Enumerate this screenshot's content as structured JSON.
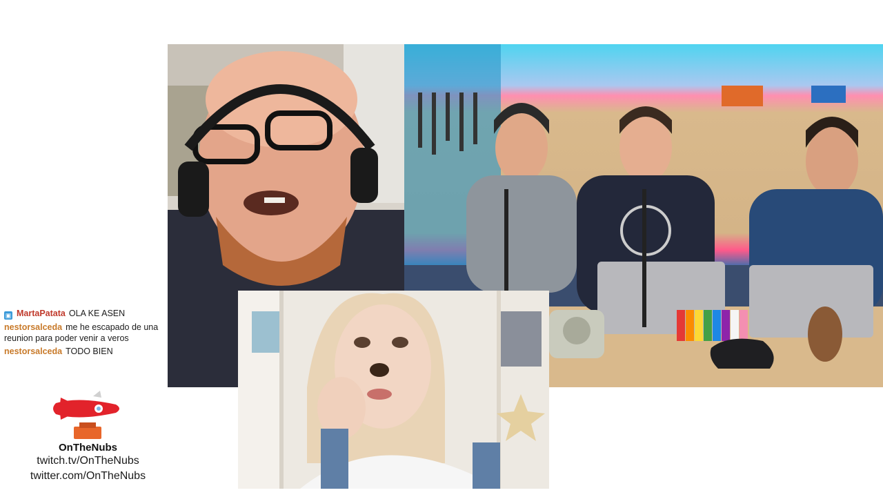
{
  "chat": {
    "messages": [
      {
        "user": "MartaPatata",
        "text": "OLA KE ASEN",
        "user_color": "#c0392b",
        "has_badge": true
      },
      {
        "user": "nestorsalceda",
        "text": "me he escapado de una reunion para poder venir a veros",
        "user_color": "#c87a2a",
        "has_badge": false
      },
      {
        "user": "nestorsalceda",
        "text": "TODO BIEN",
        "user_color": "#c87a2a",
        "has_badge": false
      }
    ]
  },
  "branding": {
    "name": "OnTheNubs",
    "twitch": "twitch.tv/OnTheNubs",
    "twitter": "twitter.com/OnTheNubs",
    "logo_icon": "rocket-logo-icon"
  },
  "video_feeds": [
    {
      "id": "webcam-left",
      "description_icon": "webcam-feed"
    },
    {
      "id": "studio-feed",
      "description_icon": "studio-feed"
    },
    {
      "id": "webcam-bottom",
      "description_icon": "webcam-feed"
    }
  ],
  "colors": {
    "badge": "#3a9ad9",
    "rocket_red": "#e2232b",
    "rocket_base": "#e8662a"
  }
}
